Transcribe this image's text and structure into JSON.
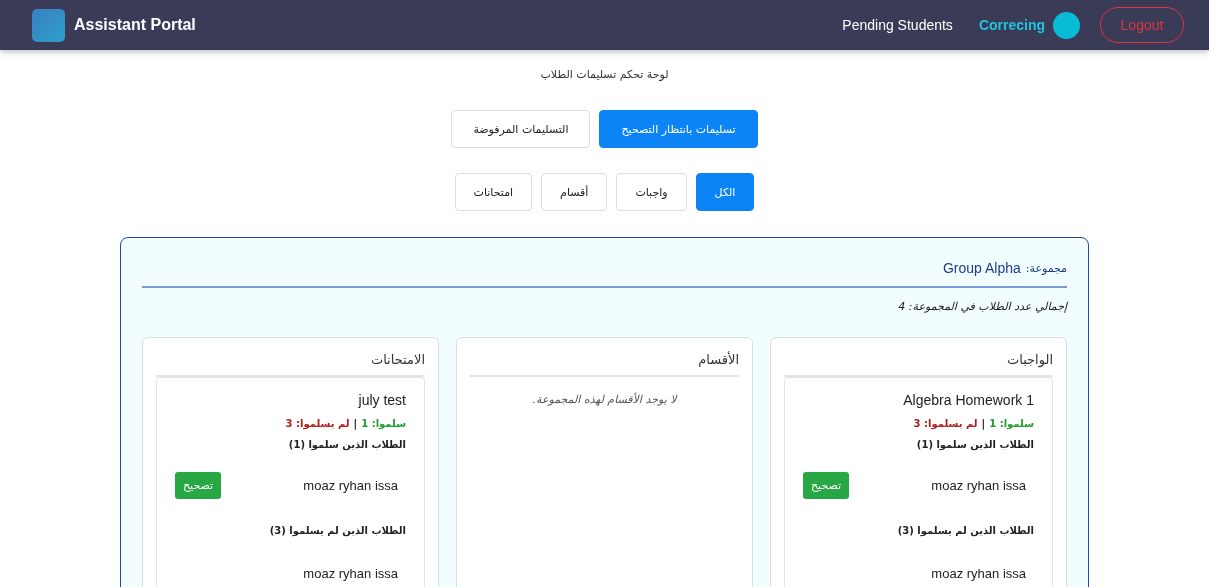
{
  "navbar": {
    "brand": "Assistant Portal",
    "links": [
      {
        "label": "Correcing",
        "selected": true
      },
      {
        "label": "Pending Students",
        "selected": false
      }
    ],
    "logout": "Logout"
  },
  "page_title": "لوحة تحكم تسليمات الطلاب",
  "status_tabs": [
    {
      "label": "تسليمات بانتظار التصحيح",
      "selected": true
    },
    {
      "label": "التسليمات المرفوضة",
      "selected": false
    }
  ],
  "type_filters": [
    {
      "label": "الكل",
      "selected": true
    },
    {
      "label": "واجبات",
      "selected": false
    },
    {
      "label": "أقسام",
      "selected": false
    },
    {
      "label": "امتحانات",
      "selected": false
    }
  ],
  "group": {
    "label": "مجموعة:",
    "name": "Group Alpha",
    "total_students": "إجمالي عدد الطلاب في المجموعة: 4",
    "columns": [
      {
        "title": "الواجبات",
        "items": [
          {
            "title": "Algebra Homework 1",
            "submitted_count": "سلموا: 1",
            "separator": "|",
            "not_submitted_count": "لم يسلموا: 3",
            "submitted_heading": "الطلاب الذين سلموا (1)",
            "submitted": [
              {
                "name": "moaz ryhan issa",
                "action": "تصحيح"
              }
            ],
            "not_submitted_heading": "الطلاب الذين لم يسلموا (3)",
            "not_submitted": [
              {
                "name": "moaz ryhan issa"
              }
            ]
          }
        ]
      },
      {
        "title": "الأقسام",
        "empty_message": "لا يوجد الأقسام لهذه المجموعة."
      },
      {
        "title": "الامتحانات",
        "items": [
          {
            "title": "july test",
            "submitted_count": "سلموا: 1",
            "separator": "|",
            "not_submitted_count": "لم يسلموا: 3",
            "submitted_heading": "الطلاب الذين سلموا (1)",
            "submitted": [
              {
                "name": "moaz ryhan issa",
                "action": "تصحيح"
              }
            ],
            "not_submitted_heading": "الطلاب الذين لم يسلموا (3)",
            "not_submitted": [
              {
                "name": "moaz ryhan issa"
              }
            ]
          }
        ]
      }
    ]
  }
}
